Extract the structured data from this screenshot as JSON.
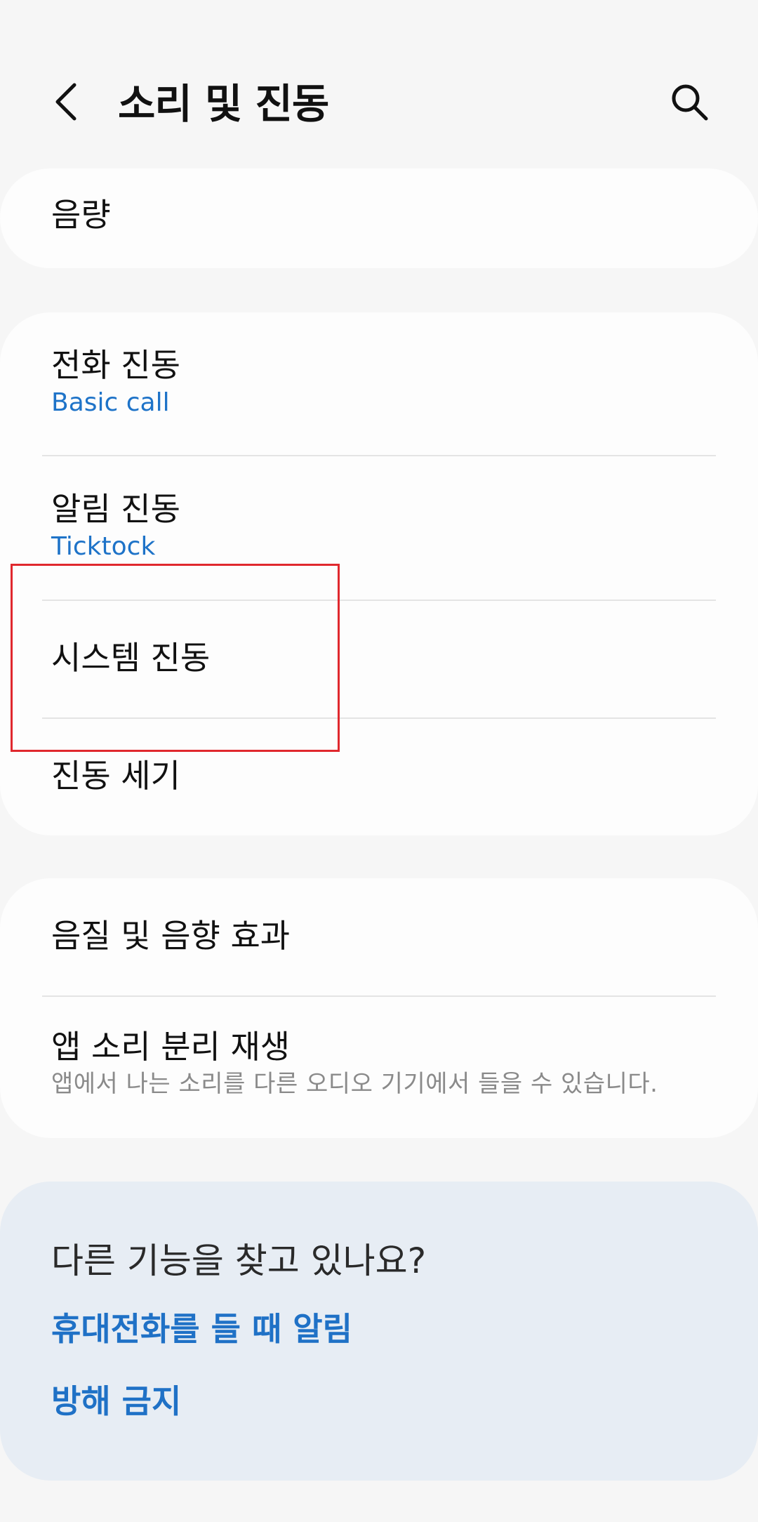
{
  "header": {
    "title": "소리 및 진동",
    "back_icon": "chevron-left-icon",
    "search_icon": "search-icon"
  },
  "volume_card": {
    "label": "음량"
  },
  "vibration_card": {
    "call_vibration": {
      "title": "전화 진동",
      "value": "Basic call"
    },
    "notification_vibration": {
      "title": "알림 진동",
      "value": "Ticktock"
    },
    "system_vibration": {
      "title": "시스템 진동"
    },
    "vibration_intensity": {
      "title": "진동 세기"
    }
  },
  "quality_card": {
    "sound_quality": {
      "title": "음질 및 음향 효과"
    },
    "separate_app_sound": {
      "title": "앱 소리 분리 재생",
      "description": "앱에서 나는 소리를 다른 오디오 기기에서 들을 수 있습니다."
    }
  },
  "suggestions": {
    "heading": "다른 기능을 찾고 있나요?",
    "links": [
      "휴대전화를 들 때 알림",
      "방해 금지"
    ]
  },
  "colors": {
    "background": "#f6f6f6",
    "card": "#fdfdfd",
    "accent_blue": "#1e73c8",
    "suggest_background": "#e7edf4",
    "highlight_red": "#e0282e"
  }
}
